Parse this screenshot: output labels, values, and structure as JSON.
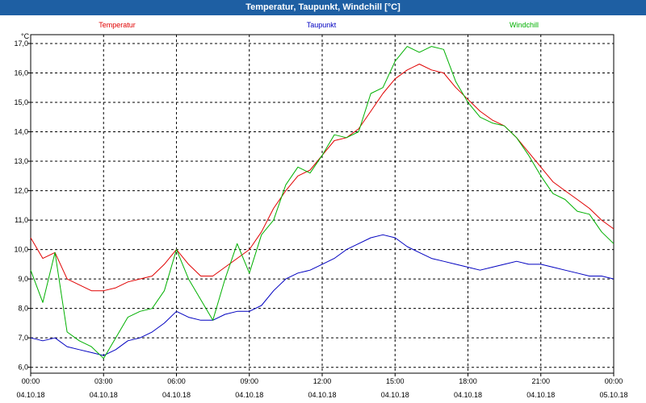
{
  "window": {
    "title": "Temperatur, Taupunkt, Windchill [°C]"
  },
  "chart_data": {
    "type": "line",
    "title": "Temperatur, Taupunkt, Windchill [°C]",
    "ylabel": "°C",
    "ylim": [
      5.8,
      17.3
    ],
    "xlim": [
      0,
      24
    ],
    "grid": true,
    "legend_position": "top",
    "colors": {
      "Temperatur": "#e00000",
      "Taupunkt": "#0000c0",
      "Windchill": "#00b000"
    },
    "y_ticks": [
      "6,0",
      "7,0",
      "8,0",
      "9,0",
      "10,0",
      "11,0",
      "12,0",
      "13,0",
      "14,0",
      "15,0",
      "16,0",
      "17,0"
    ],
    "x_ticks": [
      {
        "time": "00:00",
        "date": "04.10.18"
      },
      {
        "time": "03:00",
        "date": "04.10.18"
      },
      {
        "time": "06:00",
        "date": "04.10.18"
      },
      {
        "time": "09:00",
        "date": "04.10.18"
      },
      {
        "time": "12:00",
        "date": "04.10.18"
      },
      {
        "time": "15:00",
        "date": "04.10.18"
      },
      {
        "time": "18:00",
        "date": "04.10.18"
      },
      {
        "time": "21:00",
        "date": "04.10.18"
      },
      {
        "time": "00:00",
        "date": "05.10.18"
      }
    ],
    "x": [
      0,
      0.5,
      1,
      1.5,
      2,
      2.5,
      3,
      3.5,
      4,
      4.5,
      5,
      5.5,
      6,
      6.5,
      7,
      7.5,
      8,
      8.5,
      9,
      9.5,
      10,
      10.5,
      11,
      11.5,
      12,
      12.5,
      13,
      13.5,
      14,
      14.5,
      15,
      15.5,
      16,
      16.5,
      17,
      17.5,
      18,
      18.5,
      19,
      19.5,
      20,
      20.5,
      21,
      21.5,
      22,
      22.5,
      23,
      23.5,
      24
    ],
    "series": [
      {
        "name": "Temperatur",
        "values": [
          10.4,
          9.7,
          9.9,
          9.0,
          8.8,
          8.6,
          8.6,
          8.7,
          8.9,
          9.0,
          9.1,
          9.5,
          10.0,
          9.5,
          9.1,
          9.1,
          9.4,
          9.7,
          10.0,
          10.6,
          11.4,
          12.0,
          12.5,
          12.7,
          13.2,
          13.7,
          13.8,
          14.1,
          14.7,
          15.3,
          15.8,
          16.1,
          16.3,
          16.1,
          16.0,
          15.5,
          15.1,
          14.7,
          14.4,
          14.2,
          13.8,
          13.3,
          12.8,
          12.3,
          12.0,
          11.7,
          11.4,
          11.0,
          10.7
        ]
      },
      {
        "name": "Taupunkt",
        "values": [
          7.0,
          6.9,
          7.0,
          6.7,
          6.6,
          6.5,
          6.4,
          6.6,
          6.9,
          7.0,
          7.2,
          7.5,
          7.9,
          7.7,
          7.6,
          7.6,
          7.8,
          7.9,
          7.9,
          8.1,
          8.6,
          9.0,
          9.2,
          9.3,
          9.5,
          9.7,
          10.0,
          10.2,
          10.4,
          10.5,
          10.4,
          10.1,
          9.9,
          9.7,
          9.6,
          9.5,
          9.4,
          9.3,
          9.4,
          9.5,
          9.6,
          9.5,
          9.5,
          9.4,
          9.3,
          9.2,
          9.1,
          9.1,
          9.0
        ]
      },
      {
        "name": "Windchill",
        "values": [
          9.3,
          8.2,
          9.9,
          7.2,
          6.9,
          6.7,
          6.3,
          7.0,
          7.7,
          7.9,
          8.0,
          8.6,
          10.0,
          9.0,
          8.3,
          7.6,
          9.0,
          10.2,
          9.2,
          10.5,
          11.0,
          12.2,
          12.8,
          12.6,
          13.2,
          13.9,
          13.8,
          14.0,
          15.3,
          15.5,
          16.4,
          16.9,
          16.7,
          16.9,
          16.8,
          15.7,
          15.0,
          14.5,
          14.3,
          14.2,
          13.8,
          13.2,
          12.5,
          11.9,
          11.7,
          11.3,
          11.2,
          10.6,
          10.2
        ]
      }
    ]
  }
}
